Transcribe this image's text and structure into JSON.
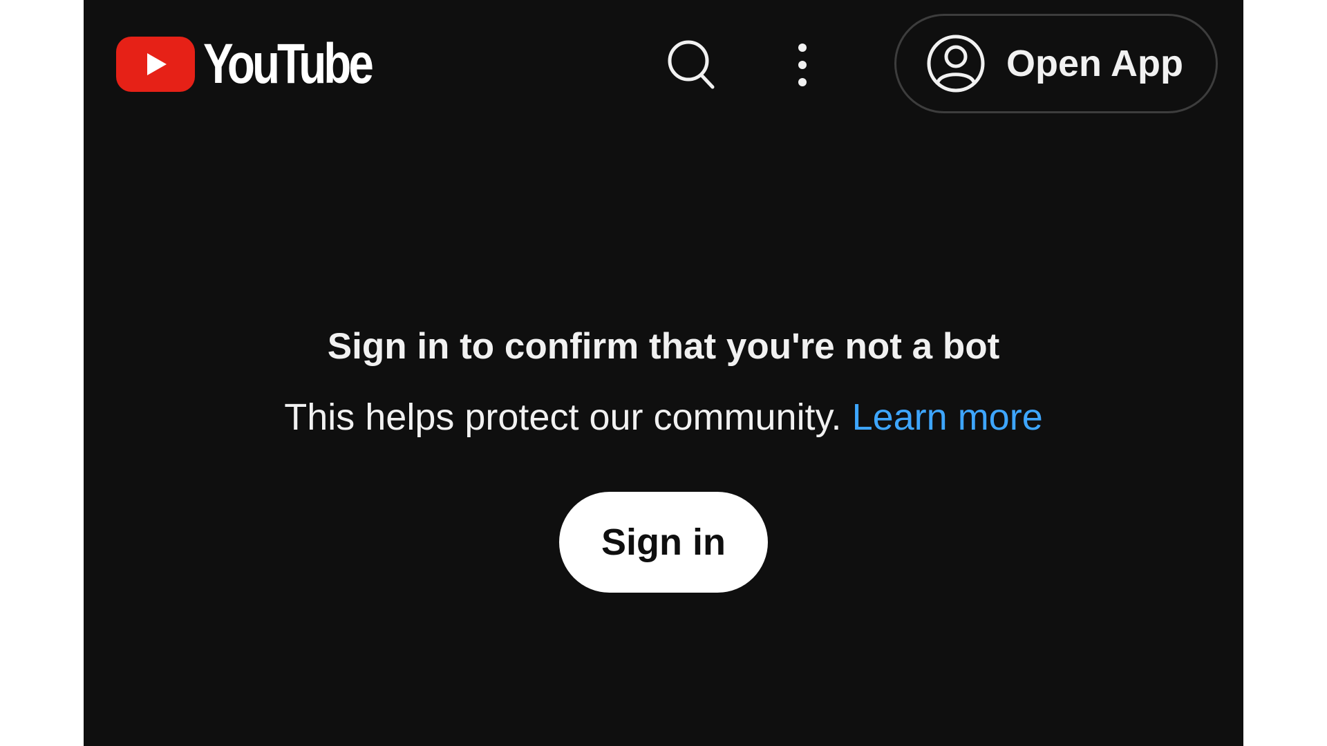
{
  "header": {
    "logo_text": "YouTube",
    "brand_color": "#e62117",
    "search_icon": "search-icon",
    "more_icon": "more-vert-icon",
    "open_app_label": "Open App",
    "open_app_icon": "account-circle-icon"
  },
  "main": {
    "title": "Sign in to confirm that you're not a bot",
    "subtitle": "This helps protect our community.",
    "learn_more": "Learn more",
    "learn_more_color": "#3ea6ff",
    "sign_in_label": "Sign in"
  }
}
